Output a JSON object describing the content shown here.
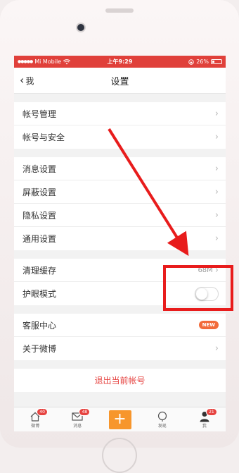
{
  "status_bar": {
    "carrier": "Mi Mobile",
    "time": "上午9:29",
    "battery": "26%",
    "battery_level": 0.26
  },
  "nav": {
    "back_label": "我",
    "title": "设置"
  },
  "groups": [
    [
      {
        "label": "帐号管理"
      },
      {
        "label": "帐号与安全"
      }
    ],
    [
      {
        "label": "消息设置"
      },
      {
        "label": "屏蔽设置"
      },
      {
        "label": "隐私设置"
      },
      {
        "label": "通用设置"
      }
    ],
    [
      {
        "label": "清理缓存",
        "value": "68M"
      },
      {
        "label": "护眼模式",
        "toggle": false
      }
    ],
    [
      {
        "label": "客服中心",
        "badge": "NEW"
      },
      {
        "label": "关于微博"
      }
    ]
  ],
  "logout_label": "退出当前帐号",
  "tabs": [
    {
      "label": "微博",
      "badge": "40",
      "icon": "home-icon"
    },
    {
      "label": "消息",
      "badge": "48",
      "icon": "envelope-icon"
    },
    {
      "label": "",
      "icon": "plus-icon"
    },
    {
      "label": "发现",
      "icon": "search-icon"
    },
    {
      "label": "我",
      "badge": "21",
      "icon": "person-icon"
    }
  ],
  "colors": {
    "status_bar": "#e0403a",
    "logout_text": "#e64340",
    "compose_button": "#f7962c",
    "annotation": "#e81c1c"
  }
}
